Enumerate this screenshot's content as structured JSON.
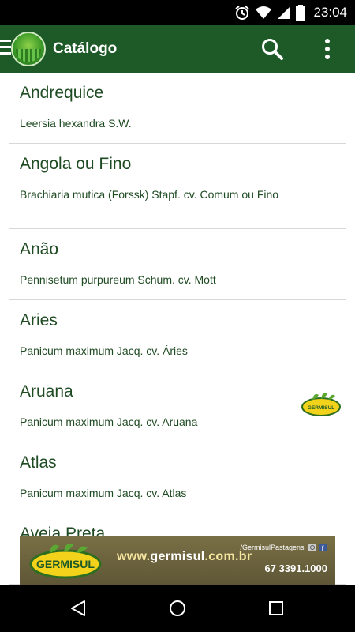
{
  "status_bar": {
    "time": "23:04"
  },
  "app_bar": {
    "title": "Catálogo"
  },
  "items": [
    {
      "name": "Andrequice",
      "scientific": "Leersia hexandra S.W.",
      "badge": false
    },
    {
      "name": "Angola ou Fino",
      "scientific": "Brachiaria mutica (Forssk) Stapf. cv. Comum ou Fino",
      "badge": false
    },
    {
      "name": "Anão",
      "scientific": "Pennisetum purpureum Schum. cv. Mott",
      "badge": false
    },
    {
      "name": "Aries",
      "scientific": "Panicum maximum Jacq. cv. Áries",
      "badge": false
    },
    {
      "name": "Aruana",
      "scientific": "Panicum maximum Jacq. cv. Aruana",
      "badge": true,
      "badge_text": "GERMISUL"
    },
    {
      "name": "Atlas",
      "scientific": "Panicum maximum Jacq. cv. Atlas",
      "badge": false
    },
    {
      "name": "Aveia Preta",
      "scientific": "",
      "badge": false
    }
  ],
  "ad": {
    "brand": "GERMISUL",
    "url_prefix": "www.",
    "url_main": "germisul",
    "url_suffix": ".com.br",
    "social": "/GermisulPastagens",
    "phone": "67 3391.1000"
  },
  "colors": {
    "app_bar": "#1e5a28",
    "text": "#1f4b23",
    "divider": "#d7d7d7"
  }
}
